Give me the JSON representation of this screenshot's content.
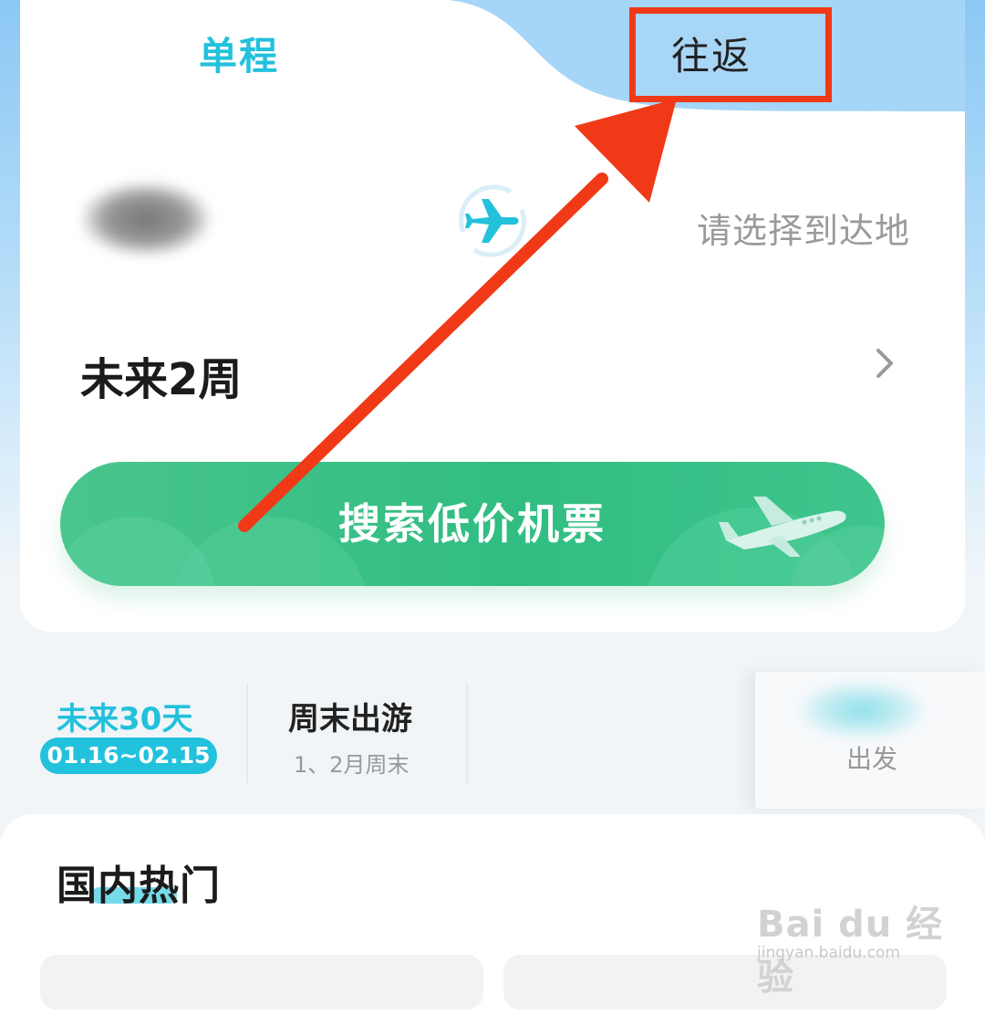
{
  "tabs": {
    "one_way": "单程",
    "round_trip": "往返"
  },
  "route": {
    "destination_placeholder": "请选择到达地"
  },
  "date": {
    "range_label": "未来2周"
  },
  "search_button": {
    "label": "搜索低价机票"
  },
  "quick_filters": [
    {
      "title": "未来30天",
      "subtitle": "01.16~02.15",
      "selected": true
    },
    {
      "title": "周末出游",
      "subtitle": "1、2月周末",
      "selected": false
    }
  ],
  "side_card": {
    "label": "出发"
  },
  "hot_section": {
    "title": "国内热门"
  },
  "watermark": {
    "text": "Bai du 经验",
    "url": "jingyan.baidu.com"
  },
  "annotation": {
    "highlight_color": "#f03a17"
  },
  "colors": {
    "accent": "#22c1dc",
    "button_green": "#3cc289"
  },
  "icons": [
    "plane-swap-icon",
    "chevron-right-icon",
    "plane-illustration-icon",
    "annotation-arrow-icon"
  ]
}
